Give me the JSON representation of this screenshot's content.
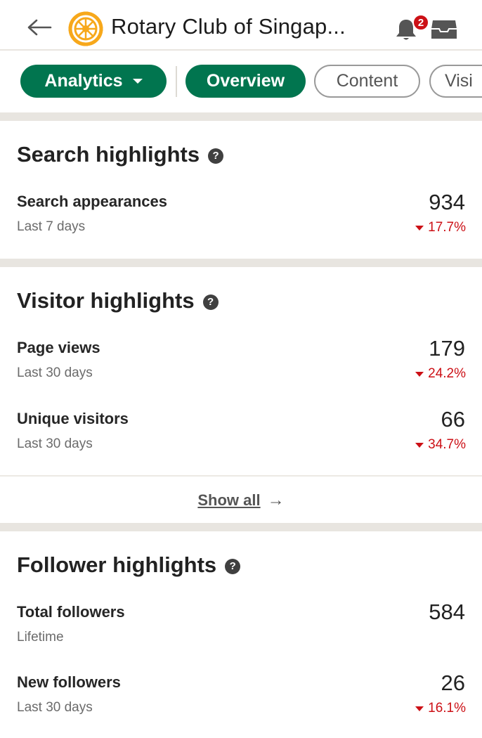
{
  "header": {
    "title": "Rotary Club of Singap...",
    "notification_count": "2",
    "icons": [
      "back-arrow-icon",
      "rotary-logo",
      "bell-icon",
      "inbox-icon"
    ]
  },
  "tabs": [
    {
      "label": "Analytics",
      "selected": true,
      "has_dropdown": true
    },
    {
      "label": "Overview",
      "selected": true
    },
    {
      "label": "Content",
      "selected": false
    },
    {
      "label": "Visi",
      "selected": false
    }
  ],
  "search_highlights": {
    "title": "Search highlights",
    "help": "?",
    "metrics": [
      {
        "label": "Search appearances",
        "period": "Last 7 days",
        "value": "934",
        "change": "17.7%",
        "direction": "down"
      }
    ]
  },
  "visitor_highlights": {
    "title": "Visitor highlights",
    "help": "?",
    "metrics": [
      {
        "label": "Page views",
        "period": "Last 30 days",
        "value": "179",
        "change": "24.2%",
        "direction": "down"
      },
      {
        "label": "Unique visitors",
        "period": "Last 30 days",
        "value": "66",
        "change": "34.7%",
        "direction": "down"
      }
    ],
    "show_all": "Show all",
    "show_all_arrow": "→"
  },
  "follower_highlights": {
    "title": "Follower highlights",
    "help": "?",
    "metrics": [
      {
        "label": "Total followers",
        "period": "Lifetime",
        "value": "584"
      },
      {
        "label": "New followers",
        "period": "Last 30 days",
        "value": "26",
        "change": "16.1%",
        "direction": "down"
      }
    ]
  },
  "colors": {
    "brand_green": "#01754f",
    "negative_red": "#cc1016",
    "rotary_gold": "#f7a81b"
  }
}
